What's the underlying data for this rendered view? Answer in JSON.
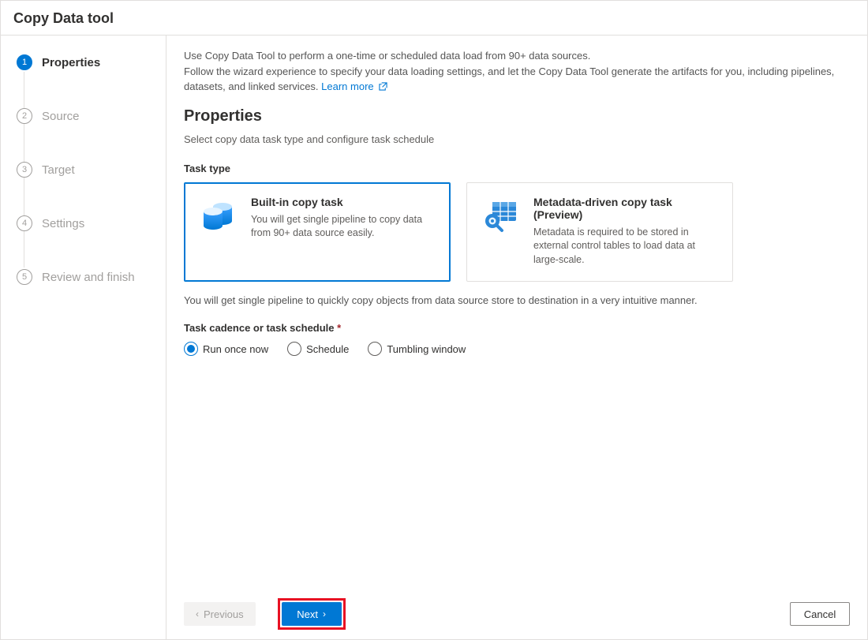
{
  "header": {
    "title": "Copy Data tool"
  },
  "sidebar": {
    "steps": [
      {
        "num": "1",
        "label": "Properties",
        "active": true
      },
      {
        "num": "2",
        "label": "Source",
        "active": false
      },
      {
        "num": "3",
        "label": "Target",
        "active": false
      },
      {
        "num": "4",
        "label": "Settings",
        "active": false
      },
      {
        "num": "5",
        "label": "Review and finish",
        "active": false
      }
    ]
  },
  "main": {
    "intro_line1": "Use Copy Data Tool to perform a one-time or scheduled data load from 90+ data sources.",
    "intro_line2": "Follow the wizard experience to specify your data loading settings, and let the Copy Data Tool generate the artifacts for you, including pipelines, datasets, and linked services. ",
    "learn_more": "Learn more",
    "section_title": "Properties",
    "section_sub": "Select copy data task type and configure task schedule",
    "task_type_label": "Task type",
    "cards": [
      {
        "title": "Built-in copy task",
        "desc": "You will get single pipeline to copy data from 90+ data source easily.",
        "selected": true
      },
      {
        "title": "Metadata-driven copy task (Preview)",
        "desc": "Metadata is required to be stored in external control tables to load data at large-scale.",
        "selected": false
      }
    ],
    "task_type_hint": "You will get single pipeline to quickly copy objects from data source store to destination in a very intuitive manner.",
    "cadence_label": "Task cadence or task schedule",
    "radios": [
      {
        "label": "Run once now",
        "selected": true
      },
      {
        "label": "Schedule",
        "selected": false
      },
      {
        "label": "Tumbling window",
        "selected": false
      }
    ]
  },
  "footer": {
    "prev": "Previous",
    "next": "Next",
    "cancel": "Cancel"
  }
}
